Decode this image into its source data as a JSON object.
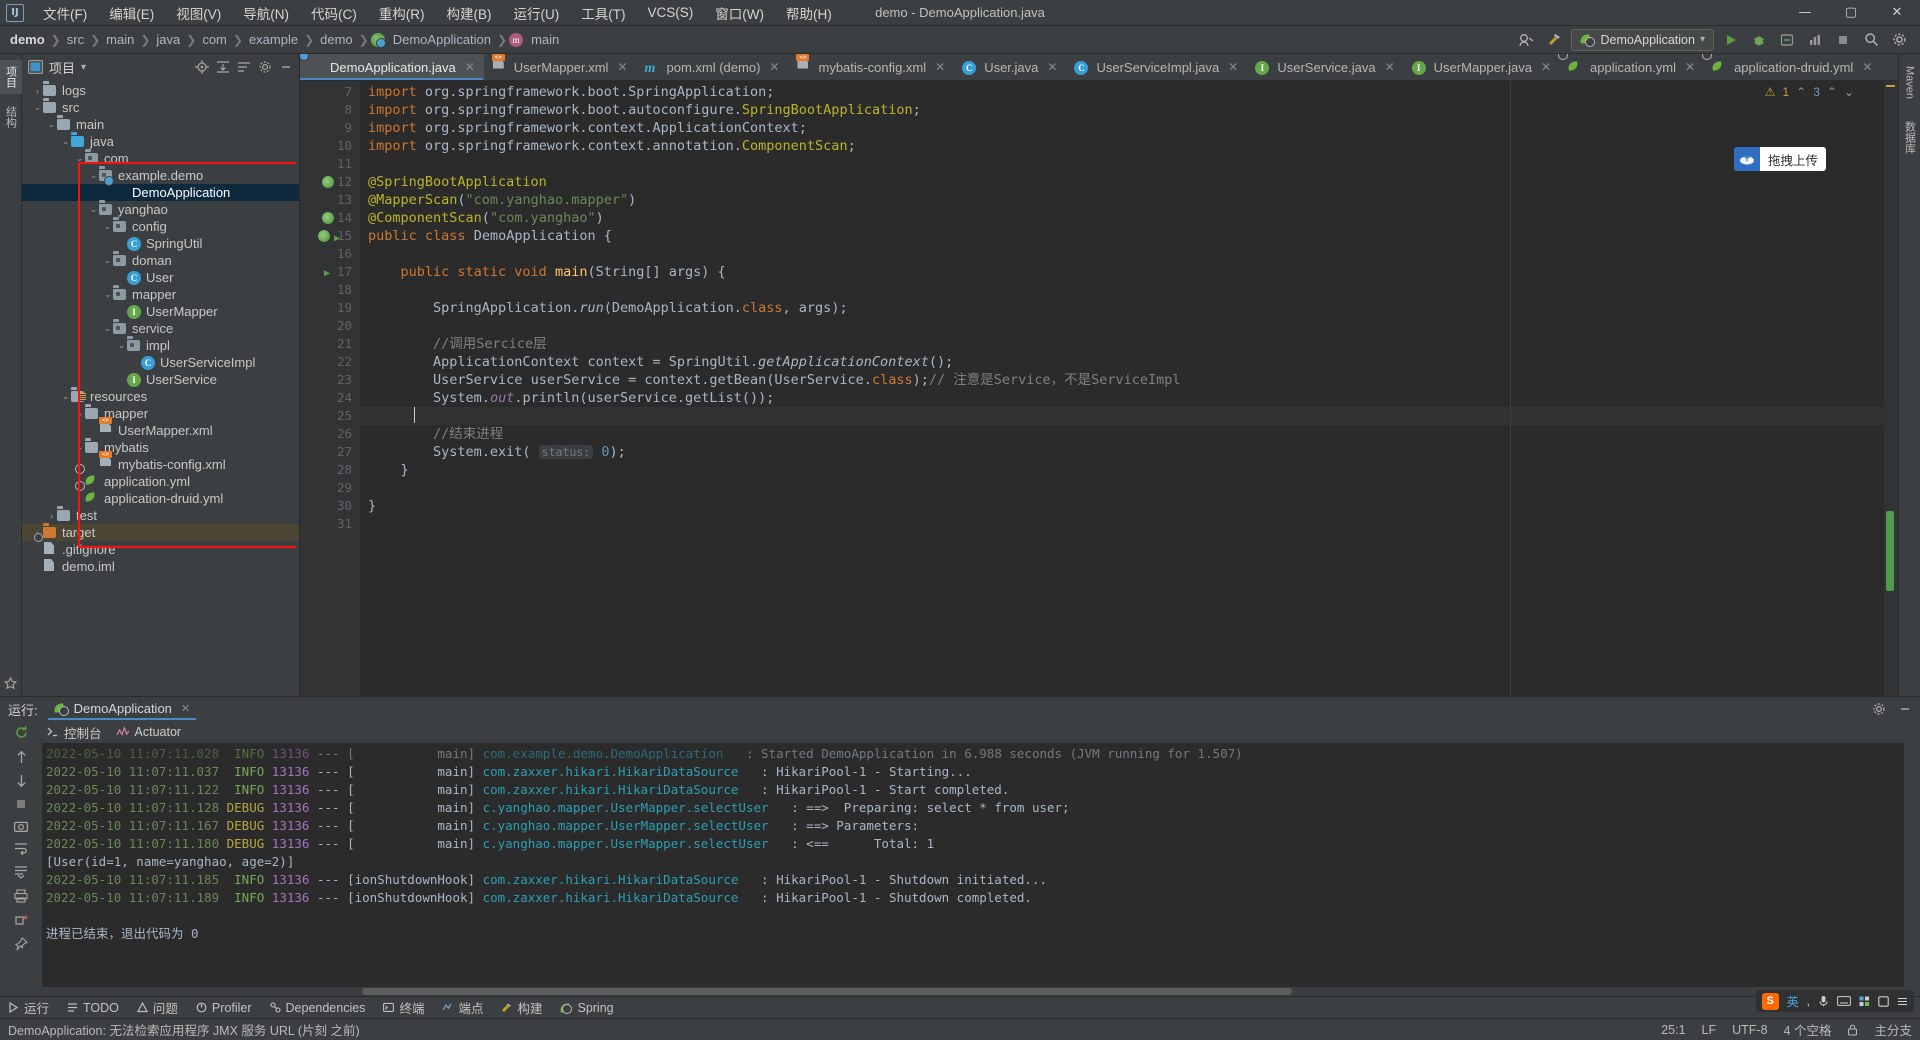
{
  "titlebar": {
    "logo": "IJ",
    "menus": [
      "文件(F)",
      "编辑(E)",
      "视图(V)",
      "导航(N)",
      "代码(C)",
      "重构(R)",
      "构建(B)",
      "运行(U)",
      "工具(T)",
      "VCS(S)",
      "窗口(W)",
      "帮助(H)"
    ],
    "window_title": "demo - DemoApplication.java",
    "minimize": "—",
    "maximize": "▢",
    "close": "✕"
  },
  "breadcrumb": {
    "items": [
      "demo",
      "src",
      "main",
      "java",
      "com",
      "example",
      "demo",
      "DemoApplication",
      "main"
    ],
    "separator": "❯"
  },
  "navbar_right": {
    "run_config": "DemoApplication",
    "dropdown_caret": "▾",
    "run": "▶",
    "debug": "🐞",
    "coverage": "▦",
    "profiler": "▤",
    "stop": "■",
    "search": "🔍",
    "settings": "⚙"
  },
  "left_rail": {
    "tabs": [
      "项目",
      "结构"
    ],
    "bottom": [
      "收藏夹"
    ]
  },
  "project_panel": {
    "title": "项目",
    "caret": "▾",
    "icons": [
      "locate-icon",
      "expand-icon",
      "collapse-icon",
      "settings-icon",
      "hide-icon"
    ],
    "tree": [
      {
        "depth": 1,
        "arrow": "›",
        "label": "logs",
        "icon": "folder",
        "state": "collapsed"
      },
      {
        "depth": 1,
        "arrow": "⌄",
        "label": "src",
        "icon": "folder",
        "state": "expanded"
      },
      {
        "depth": 2,
        "arrow": "⌄",
        "label": "main",
        "icon": "folder",
        "state": "expanded"
      },
      {
        "depth": 3,
        "arrow": "⌄",
        "label": "java",
        "icon": "folder-blue",
        "state": "expanded"
      },
      {
        "depth": 4,
        "arrow": "⌄",
        "label": "com",
        "icon": "package",
        "state": "expanded"
      },
      {
        "depth": 5,
        "arrow": "⌄",
        "label": "example.demo",
        "icon": "package",
        "state": "expanded"
      },
      {
        "depth": 6,
        "arrow": "",
        "label": "DemoApplication",
        "icon": "spring-class",
        "state": "selected"
      },
      {
        "depth": 5,
        "arrow": "⌄",
        "label": "yanghao",
        "icon": "package",
        "state": "expanded"
      },
      {
        "depth": 6,
        "arrow": "⌄",
        "label": "config",
        "icon": "package",
        "state": "expanded"
      },
      {
        "depth": 7,
        "arrow": "",
        "label": "SpringUtil",
        "icon": "class",
        "state": "leaf"
      },
      {
        "depth": 6,
        "arrow": "⌄",
        "label": "doman",
        "icon": "package",
        "state": "expanded"
      },
      {
        "depth": 7,
        "arrow": "",
        "label": "User",
        "icon": "class",
        "state": "leaf"
      },
      {
        "depth": 6,
        "arrow": "⌄",
        "label": "mapper",
        "icon": "package",
        "state": "expanded"
      },
      {
        "depth": 7,
        "arrow": "",
        "label": "UserMapper",
        "icon": "interface",
        "state": "leaf"
      },
      {
        "depth": 6,
        "arrow": "⌄",
        "label": "service",
        "icon": "package",
        "state": "expanded"
      },
      {
        "depth": 7,
        "arrow": "⌄",
        "label": "impl",
        "icon": "package",
        "state": "expanded"
      },
      {
        "depth": 8,
        "arrow": "",
        "label": "UserServiceImpl",
        "icon": "class",
        "state": "leaf"
      },
      {
        "depth": 7,
        "arrow": "",
        "label": "UserService",
        "icon": "interface",
        "state": "leaf"
      },
      {
        "depth": 3,
        "arrow": "⌄",
        "label": "resources",
        "icon": "folder-res",
        "state": "expanded"
      },
      {
        "depth": 4,
        "arrow": "⌄",
        "label": "mapper",
        "icon": "folder",
        "state": "expanded"
      },
      {
        "depth": 5,
        "arrow": "",
        "label": "UserMapper.xml",
        "icon": "xml",
        "state": "leaf"
      },
      {
        "depth": 4,
        "arrow": "⌄",
        "label": "mybatis",
        "icon": "folder",
        "state": "expanded"
      },
      {
        "depth": 5,
        "arrow": "",
        "label": "mybatis-config.xml",
        "icon": "xml",
        "state": "leaf"
      },
      {
        "depth": 4,
        "arrow": "",
        "label": "application.yml",
        "icon": "spring-yml",
        "state": "leaf"
      },
      {
        "depth": 4,
        "arrow": "",
        "label": "application-druid.yml",
        "icon": "spring-yml",
        "state": "leaf"
      },
      {
        "depth": 2,
        "arrow": "›",
        "label": "test",
        "icon": "folder",
        "state": "collapsed"
      },
      {
        "depth": 1,
        "arrow": "›",
        "label": "target",
        "icon": "folder-orange",
        "state": "highlighted"
      },
      {
        "depth": 1,
        "arrow": "",
        "label": ".gitignore",
        "icon": "gitignore",
        "state": "leaf"
      },
      {
        "depth": 1,
        "arrow": "",
        "label": "demo.iml",
        "icon": "iml",
        "state": "leaf"
      }
    ]
  },
  "editor": {
    "tabs": [
      {
        "label": "DemoApplication.java",
        "icon": "spring-class",
        "active": true
      },
      {
        "label": "UserMapper.xml",
        "icon": "xml",
        "active": false
      },
      {
        "label": "pom.xml (demo)",
        "icon": "maven",
        "active": false
      },
      {
        "label": "mybatis-config.xml",
        "icon": "xml",
        "active": false
      },
      {
        "label": "User.java",
        "icon": "class",
        "active": false
      },
      {
        "label": "UserServiceImpl.java",
        "icon": "class",
        "active": false
      },
      {
        "label": "UserService.java",
        "icon": "interface",
        "active": false
      },
      {
        "label": "UserMapper.java",
        "icon": "interface",
        "active": false
      },
      {
        "label": "application.yml",
        "icon": "spring-yml",
        "active": false
      },
      {
        "label": "application-druid.yml",
        "icon": "spring-yml",
        "active": false
      }
    ],
    "close_glyph": "✕",
    "inspections": {
      "warn_count": "1",
      "weak_count": "3",
      "warn_glyph": "⚠",
      "weak_glyph": "⌃",
      "up": "⌃",
      "down": "⌄"
    },
    "upload_button": {
      "label": "拖拽上传",
      "icon": "cloud-upload-icon"
    },
    "first_line_no": 7,
    "lines": [
      {
        "n": 7,
        "mark": "",
        "tokens": [
          {
            "t": "import org.springframework.boot.",
            "c": "kw-import"
          },
          {
            "t": "SpringApplication;",
            "c": "plain-semi"
          }
        ]
      },
      {
        "n": 8,
        "mark": "",
        "tokens": []
      },
      {
        "n": 9,
        "mark": "",
        "tokens": []
      },
      {
        "n": 10,
        "mark": "fold",
        "tokens": []
      },
      {
        "n": 11,
        "mark": "",
        "tokens": []
      },
      {
        "n": 12,
        "mark": "bean",
        "tokens": []
      },
      {
        "n": 13,
        "mark": "",
        "tokens": []
      },
      {
        "n": 14,
        "mark": "bean",
        "tokens": []
      },
      {
        "n": 15,
        "mark": "spring-run",
        "tokens": []
      },
      {
        "n": 16,
        "mark": "",
        "tokens": []
      },
      {
        "n": 17,
        "mark": "run",
        "tokens": []
      },
      {
        "n": 18,
        "mark": "",
        "tokens": []
      },
      {
        "n": 19,
        "mark": "",
        "tokens": []
      },
      {
        "n": 20,
        "mark": "",
        "tokens": []
      },
      {
        "n": 21,
        "mark": "",
        "tokens": []
      },
      {
        "n": 22,
        "mark": "",
        "tokens": []
      },
      {
        "n": 23,
        "mark": "",
        "tokens": []
      },
      {
        "n": 24,
        "mark": "",
        "tokens": []
      },
      {
        "n": 25,
        "mark": "",
        "tokens": []
      },
      {
        "n": 26,
        "mark": "",
        "tokens": []
      },
      {
        "n": 27,
        "mark": "",
        "tokens": []
      },
      {
        "n": 28,
        "mark": "",
        "tokens": []
      },
      {
        "n": 29,
        "mark": "",
        "tokens": []
      },
      {
        "n": 30,
        "mark": "",
        "tokens": []
      },
      {
        "n": 31,
        "mark": "",
        "tokens": []
      }
    ],
    "code_text": {
      "l7": "import org.springframework.boot.SpringApplication;",
      "l8": "import org.springframework.boot.autoconfigure.SpringBootApplication;",
      "l9": "import org.springframework.context.ApplicationContext;",
      "l10": "import org.springframework.context.annotation.ComponentScan;",
      "l12": "@SpringBootApplication",
      "l13": "@MapperScan(\"com.yanghao.mapper\")",
      "l14": "@ComponentScan(\"com.yanghao\")",
      "l15": "public class DemoApplication {",
      "l17": "public static void main(String[] args) {",
      "l19": "SpringApplication.run(DemoApplication.class, args);",
      "l21": "//调用Sercice层",
      "l22": "ApplicationContext context = SpringUtil.getApplicationContext();",
      "l23": "UserService userService = context.getBean(UserService.class);// 注意是Service，不是ServiceImpl",
      "l24": "System.out.println(userService.getList());",
      "l26": "//结束进程",
      "l27": "System.exit( status: 0);",
      "l28": "}",
      "l30": "}",
      "hint_status": "status:"
    }
  },
  "right_rail": {
    "items": [
      "Maven",
      "数据库"
    ]
  },
  "run_panel": {
    "label": "运行:",
    "config_tab": "DemoApplication",
    "close_glyph": "✕",
    "tabs": [
      {
        "label": "控制台",
        "icon": "console-icon"
      },
      {
        "label": "Actuator",
        "icon": "actuator-icon"
      }
    ],
    "settings_icon": "gear-icon",
    "minimize_icon": "minimize-icon",
    "side_icons": [
      "rerun-icon",
      "up-icon",
      "down-icon",
      "stop-icon",
      "camera-icon",
      "soft-wrap-icon",
      "print-icon",
      "scroll-end-icon",
      "clear-icon",
      "pin-icon"
    ],
    "console_lines": [
      {
        "date": "2022-05-10 11:07:11.028",
        "level": "INFO",
        "pid": "13136",
        "dash": "--- [",
        "thread": "           main]",
        "cls": "com.example.demo.DemoApplication",
        "msg": ": Started DemoApplication in 6.988 seconds (JVM running for 1.507)",
        "partial": true
      },
      {
        "date": "2022-05-10 11:07:11.037",
        "level": "INFO",
        "pid": "13136",
        "dash": "--- [",
        "thread": "           main]",
        "cls": "com.zaxxer.hikari.HikariDataSource",
        "msg": ": HikariPool-1 - Starting..."
      },
      {
        "date": "2022-05-10 11:07:11.122",
        "level": "INFO",
        "pid": "13136",
        "dash": "--- [",
        "thread": "           main]",
        "cls": "com.zaxxer.hikari.HikariDataSource",
        "msg": ": HikariPool-1 - Start completed."
      },
      {
        "date": "2022-05-10 11:07:11.128",
        "level": "DEBUG",
        "pid": "13136",
        "dash": "--- [",
        "thread": "           main]",
        "cls": "c.yanghao.mapper.UserMapper.selectUser",
        "msg": ": ==>  Preparing: select * from user;"
      },
      {
        "date": "2022-05-10 11:07:11.167",
        "level": "DEBUG",
        "pid": "13136",
        "dash": "--- [",
        "thread": "           main]",
        "cls": "c.yanghao.mapper.UserMapper.selectUser",
        "msg": ": ==> Parameters:"
      },
      {
        "date": "2022-05-10 11:07:11.180",
        "level": "DEBUG",
        "pid": "13136",
        "dash": "--- [",
        "thread": "           main]",
        "cls": "c.yanghao.mapper.UserMapper.selectUser",
        "msg": ": <==      Total: 1"
      },
      {
        "plain": "[User(id=1, name=yanghao, age=2)]"
      },
      {
        "date": "2022-05-10 11:07:11.185",
        "level": "INFO",
        "pid": "13136",
        "dash": "--- [",
        "thread": "ionShutdownHook]",
        "cls": "com.zaxxer.hikari.HikariDataSource",
        "msg": ": HikariPool-1 - Shutdown initiated..."
      },
      {
        "date": "2022-05-10 11:07:11.189",
        "level": "INFO",
        "pid": "13136",
        "dash": "--- [",
        "thread": "ionShutdownHook]",
        "cls": "com.zaxxer.hikari.HikariDataSource",
        "msg": ": HikariPool-1 - Shutdown completed."
      },
      {
        "plain": ""
      },
      {
        "plain": "进程已结束，退出代码为 0"
      }
    ]
  },
  "toolwindow_bar": {
    "items": [
      {
        "label": "运行",
        "icon": "run-icon"
      },
      {
        "label": "TODO",
        "icon": "todo-icon"
      },
      {
        "label": "问题",
        "icon": "problems-icon"
      },
      {
        "label": "Profiler",
        "icon": "profiler-icon"
      },
      {
        "label": "Dependencies",
        "icon": "dependencies-icon"
      },
      {
        "label": "终端",
        "icon": "terminal-icon"
      },
      {
        "label": "端点",
        "icon": "endpoints-icon"
      },
      {
        "label": "构建",
        "icon": "build-icon"
      },
      {
        "label": "Spring",
        "icon": "spring-icon"
      }
    ]
  },
  "statusbar": {
    "message": "DemoApplication: 无法检索应用程序 JMX 服务 URL (片刻 之前)",
    "caret": "25:1",
    "line_sep": "LF",
    "encoding": "UTF-8",
    "indent": "4 个空格",
    "branch": "主分支",
    "lock_icon": "lock-icon"
  },
  "ime_bar": {
    "logo": "S",
    "mode": "英",
    "icons": [
      "comma-icon",
      "mic-icon",
      "keyboard-icon",
      "grid-icon",
      "box-icon",
      "menu-icon"
    ]
  },
  "colors": {
    "bg": "#3c3f41",
    "editor_bg": "#2b2b2b",
    "gutter": "#313335",
    "accent": "#4a88c7",
    "selection": "#0d293e",
    "red_box": "#ff1010",
    "keyword": "#cc7832",
    "string": "#6a8759",
    "annotation": "#bbb529",
    "comment": "#808080",
    "field": "#9876aa",
    "number": "#6897bb",
    "plain": "#a9b7c6"
  }
}
